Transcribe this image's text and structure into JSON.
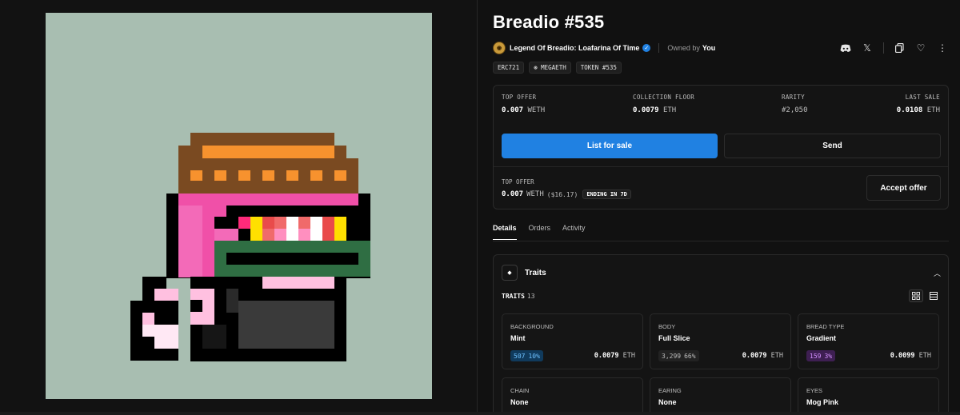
{
  "item": {
    "title": "Breadio #535",
    "collection_name": "Legend Of Breadio: Loafarina Of Time",
    "owned_label": "Owned by",
    "owner": "You",
    "chips": [
      "ERC721",
      "⊛ MEGAETH",
      "TOKEN #535"
    ]
  },
  "header_icons": [
    "discord-icon",
    "x-icon",
    "copy-icon",
    "heart-icon",
    "more-icon"
  ],
  "stats": {
    "top_offer": {
      "label": "TOP OFFER",
      "value": "0.007",
      "unit": "WETH"
    },
    "collection_floor": {
      "label": "COLLECTION FLOOR",
      "value": "0.0079",
      "unit": "ETH"
    },
    "rarity": {
      "label": "RARITY",
      "value": "#2,050"
    },
    "last_sale": {
      "label": "LAST SALE",
      "value": "0.0108",
      "unit": "ETH"
    }
  },
  "actions": {
    "list_for_sale": "List for sale",
    "send": "Send",
    "accept_offer": "Accept offer"
  },
  "offer": {
    "label": "TOP OFFER",
    "value": "0.007",
    "unit": "WETH",
    "usd": "($16.17)",
    "ending": "ENDING IN 7D"
  },
  "tabs": [
    "Details",
    "Orders",
    "Activity"
  ],
  "traits_section": {
    "title": "Traits",
    "count_label": "TRAITS",
    "count": "13"
  },
  "traits": [
    {
      "type": "BACKGROUND",
      "value": "Mint",
      "count": "507",
      "pct": "10%",
      "floor": "0.0079",
      "unit": "ETH",
      "badge_bg": "#103a5c",
      "badge_fg": "#6ec1ff"
    },
    {
      "type": "BODY",
      "value": "Full Slice",
      "count": "3,299",
      "pct": "66%",
      "floor": "0.0079",
      "unit": "ETH",
      "badge_bg": "#222222",
      "badge_fg": "#bdbdbd"
    },
    {
      "type": "BREAD TYPE",
      "value": "Gradient",
      "count": "159",
      "pct": "3%",
      "floor": "0.0099",
      "unit": "ETH",
      "badge_bg": "#3e1f52",
      "badge_fg": "#d490ff"
    },
    {
      "type": "CHAIN",
      "value": "None"
    },
    {
      "type": "EARING",
      "value": "None"
    },
    {
      "type": "EYES",
      "value": "Mog Pink"
    }
  ],
  "colors": {
    "accent": "#2081e2",
    "background": "#111111",
    "art_background": "#a8beb1"
  }
}
